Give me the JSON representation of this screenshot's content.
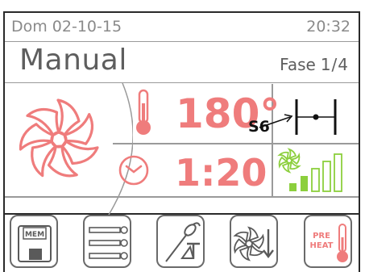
{
  "status": {
    "date": "Dom 02-10-15",
    "time": "20:32"
  },
  "mode": {
    "name": "Manual",
    "phase_label": "Fase",
    "phase_value": "1/4"
  },
  "temperature": {
    "value": "180°",
    "sensor": "S6"
  },
  "timer": {
    "value": "1:20"
  },
  "buttons": [
    {
      "name": "mem",
      "label": "MEM"
    },
    {
      "name": "multi-timer",
      "label": ""
    },
    {
      "name": "probe",
      "label": ""
    },
    {
      "name": "fan-down",
      "label": ""
    },
    {
      "name": "preheat",
      "label": "PRE HEAT"
    }
  ],
  "colors": {
    "accent": "#ef7c7c",
    "green": "#8ccf3d",
    "text": "#5e5e5e",
    "status": "#8a8a8a"
  },
  "icons": [
    "fan-icon",
    "thermometer-icon",
    "humidity-setting-icon",
    "timer-icon",
    "fan-speed-icon",
    "floppy-icon",
    "multi-timer-icon",
    "probe-icon",
    "fan-down-icon",
    "preheat-icon"
  ]
}
